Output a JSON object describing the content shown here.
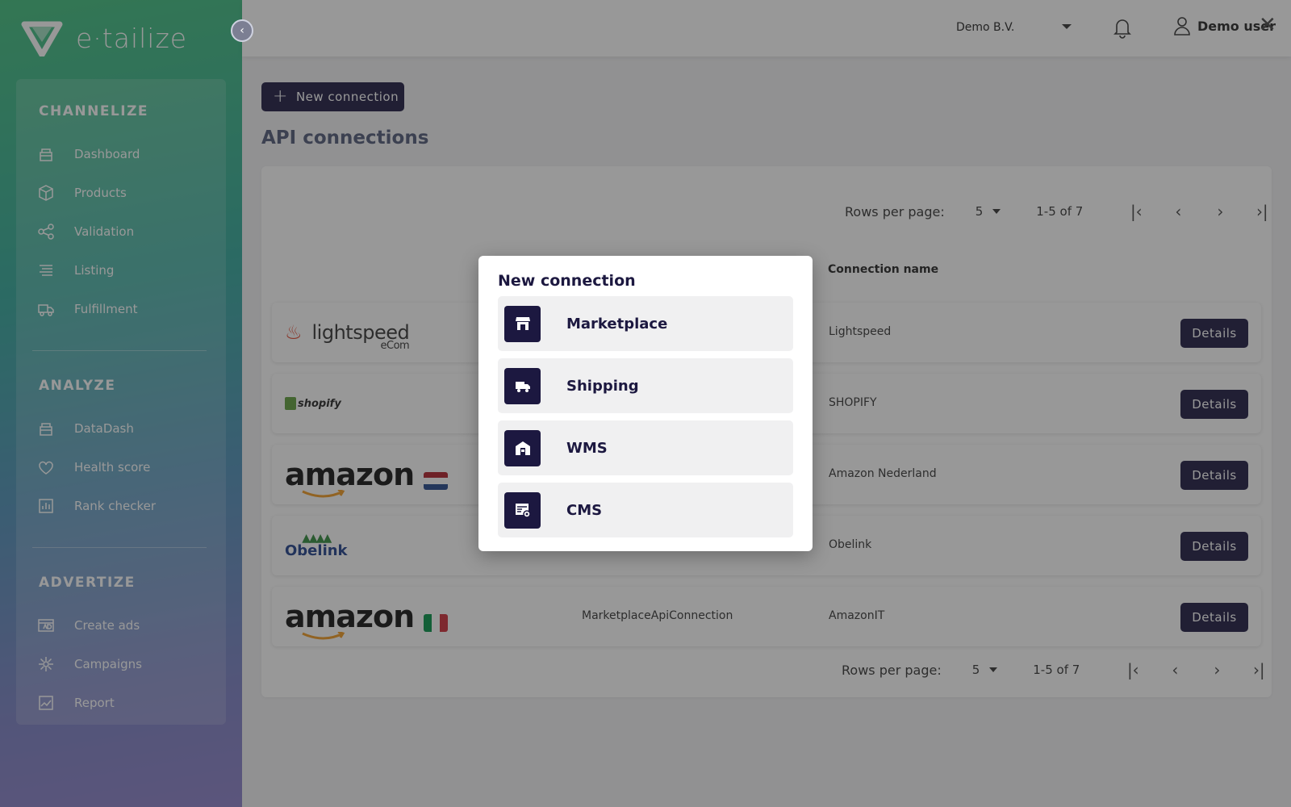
{
  "app": {
    "brand": "e·tailize"
  },
  "sidebar": {
    "sections": [
      {
        "title": "CHANNELIZE",
        "items": [
          {
            "label": "Dashboard",
            "icon": "dashboard-icon"
          },
          {
            "label": "Products",
            "icon": "box-icon"
          },
          {
            "label": "Validation",
            "icon": "share-icon"
          },
          {
            "label": "Listing",
            "icon": "list-icon"
          },
          {
            "label": "Fulfillment",
            "icon": "truck-icon"
          }
        ]
      },
      {
        "title": "ANALYZE",
        "items": [
          {
            "label": "DataDash",
            "icon": "dashboard-icon"
          },
          {
            "label": "Health score",
            "icon": "heart-icon"
          },
          {
            "label": "Rank checker",
            "icon": "bar-chart-icon"
          }
        ]
      },
      {
        "title": "ADVERTIZE",
        "items": [
          {
            "label": "Create ads",
            "icon": "ad-icon"
          },
          {
            "label": "Campaigns",
            "icon": "sparkle-icon"
          },
          {
            "label": "Report",
            "icon": "line-chart-icon"
          }
        ]
      }
    ]
  },
  "topbar": {
    "company": "Demo B.V.",
    "user": "Demo user",
    "close": "✕"
  },
  "main": {
    "new_connection_label": "New connection",
    "title": "API connections",
    "pager": {
      "rows_per_page_label": "Rows per page:",
      "rows_per_page": "5",
      "range": "1-5 of 7"
    },
    "column_connection_name": "Connection name",
    "details_label": "Details",
    "rows": [
      {
        "logo": "lightspeed",
        "logo_text": "lightspeed",
        "logo_sub": "eCom",
        "type": "",
        "name": "Lightspeed"
      },
      {
        "logo": "shopify",
        "logo_text": "shopify",
        "type": "",
        "name": "SHOPIFY"
      },
      {
        "logo": "amazon-nl",
        "logo_text": "amazon",
        "type": "",
        "name": "Amazon Nederland"
      },
      {
        "logo": "obelink",
        "logo_text": "Obelink",
        "type": "",
        "name": "Obelink"
      },
      {
        "logo": "amazon-it",
        "logo_text": "amazon",
        "type": "MarketplaceApiConnection",
        "name": "AmazonIT"
      }
    ]
  },
  "modal": {
    "title": "New connection",
    "options": [
      {
        "label": "Marketplace",
        "icon": "store-icon"
      },
      {
        "label": "Shipping",
        "icon": "truck-icon"
      },
      {
        "label": "WMS",
        "icon": "warehouse-icon"
      },
      {
        "label": "CMS",
        "icon": "cms-icon"
      }
    ]
  },
  "colors": {
    "primary": "#1c1840",
    "title": "#4f5877",
    "overlay": "rgba(40,40,40,0.48)"
  }
}
